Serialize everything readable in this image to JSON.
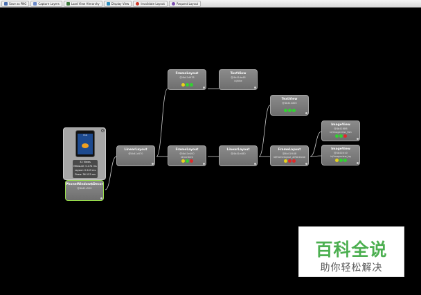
{
  "toolbar": {
    "buttons": [
      {
        "label": "Save as PNG",
        "icon": "save-icon",
        "color": "#4a6fb0"
      },
      {
        "label": "Capture Layers",
        "icon": "layers-icon",
        "color": "#6b8ac9"
      },
      {
        "label": "Load View Hierarchy",
        "icon": "hierarchy-icon",
        "color": "#3c7a3c"
      },
      {
        "label": "Display View",
        "icon": "display-icon",
        "color": "#2f8fbf"
      },
      {
        "label": "Invalidate Layout",
        "icon": "invalidate-icon",
        "color": "#d03a2a"
      },
      {
        "label": "Request Layout",
        "icon": "request-icon",
        "color": "#7a4fb0"
      }
    ]
  },
  "colors": {
    "green": "#32d232",
    "yellow": "#e8d21c",
    "red": "#e02a2a"
  },
  "preview": {
    "phone_label": "ImG",
    "metrics": [
      "32 Views",
      "Measure: 0.174 ms",
      "Layout: 0.243 ms",
      "Draw: 36.153 ms"
    ]
  },
  "nodes": [
    {
      "title": "PhoneWindow$DecorView",
      "id": "@4b41c520",
      "extra": "",
      "dots": []
    },
    {
      "title": "LinearLayout",
      "id": "@4b41c670",
      "extra": "",
      "dots": []
    },
    {
      "title": "FrameLayout",
      "id": "@4b41d978",
      "extra": "",
      "dots": [
        "yellow",
        "green",
        "green"
      ]
    },
    {
      "title": "TextView",
      "id": "@4b41da48",
      "extra": "id/title",
      "dots": []
    },
    {
      "title": "FrameLayout",
      "id": "@4b41e400",
      "extra": "id/content",
      "dots": [
        "yellow",
        "green",
        "red"
      ]
    },
    {
      "title": "LinearLayout",
      "id": "@4b41e480",
      "extra": "",
      "dots": []
    },
    {
      "title": "TextView",
      "id": "@4b41ed00",
      "extra": "",
      "dots": [
        "green",
        "green",
        "green"
      ]
    },
    {
      "title": "FrameLayout",
      "id": "@4b41f448",
      "extra": "id/framelayout_alfisheaval",
      "dots": [
        "yellow",
        "red",
        "red"
      ]
    },
    {
      "title": "ImageView",
      "id": "@4b41f8f8",
      "extra": "id/imageview_fish",
      "dots": [
        "green",
        "green",
        "red"
      ]
    },
    {
      "title": "ImageView",
      "id": "@4b41fcc0",
      "extra": "id/imageview_bg",
      "dots": [
        "yellow",
        "green",
        "green"
      ]
    }
  ],
  "watermark": {
    "title": "百科全说",
    "subtitle": "助你轻松解决"
  }
}
